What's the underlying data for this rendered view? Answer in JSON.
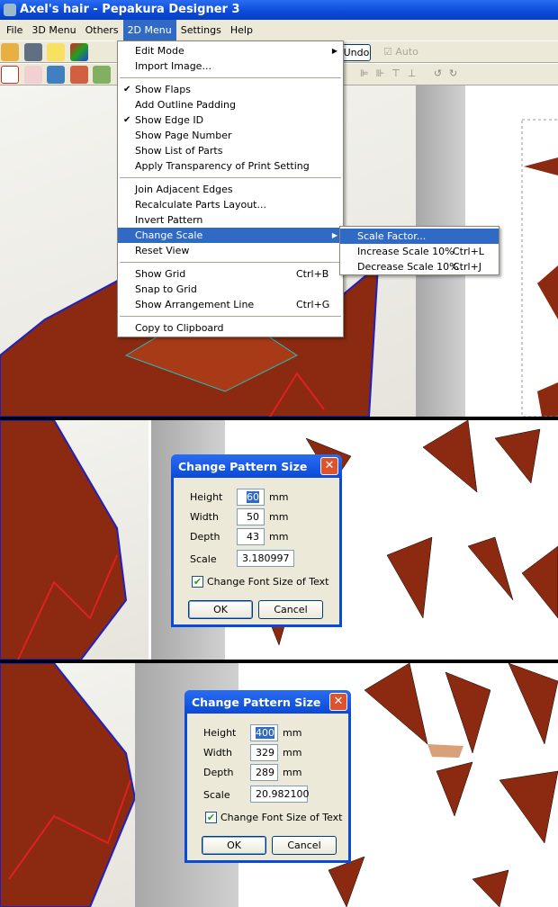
{
  "window": {
    "title": "Axel's hair - Pepakura Designer 3"
  },
  "menubar": [
    "File",
    "3D Menu",
    "Others",
    "2D Menu",
    "Settings",
    "Help"
  ],
  "toolbar": {
    "undo": "Undo",
    "auto": "Auto"
  },
  "menu_2d": {
    "items": [
      {
        "label": "Edit Mode",
        "submenu": true
      },
      {
        "label": "Import Image..."
      },
      {
        "label": "Show Flaps",
        "checked": true
      },
      {
        "label": "Add Outline Padding"
      },
      {
        "label": "Show Edge ID",
        "checked": true
      },
      {
        "label": "Show Page Number"
      },
      {
        "label": "Show List of Parts"
      },
      {
        "label": "Apply Transparency of Print Setting"
      },
      {
        "label": "Join Adjacent Edges"
      },
      {
        "label": "Recalculate Parts Layout..."
      },
      {
        "label": "Invert Pattern"
      },
      {
        "label": "Change Scale",
        "submenu": true,
        "highlighted": true
      },
      {
        "label": "Reset View"
      },
      {
        "label": "Show Grid",
        "shortcut": "Ctrl+B"
      },
      {
        "label": "Snap to Grid"
      },
      {
        "label": "Show Arrangement Line",
        "shortcut": "Ctrl+G"
      },
      {
        "label": "Copy to Clipboard"
      }
    ]
  },
  "submenu_scale": [
    {
      "label": "Scale Factor...",
      "highlighted": true
    },
    {
      "label": "Increase Scale 10%",
      "shortcut": "Ctrl+L"
    },
    {
      "label": "Decrease Scale 10%",
      "shortcut": "Ctrl+J"
    }
  ],
  "dialogs": [
    {
      "title": "Change Pattern Size",
      "height_label": "Height",
      "height": "60",
      "width_label": "Width",
      "width": "50",
      "depth_label": "Depth",
      "depth": "43",
      "unit": "mm",
      "scale_label": "Scale",
      "scale": "3.180997",
      "checkbox": "Change Font Size of Text",
      "checked": true,
      "ok": "OK",
      "cancel": "Cancel",
      "close": "✕"
    },
    {
      "title": "Change Pattern Size",
      "height_label": "Height",
      "height": "400",
      "width_label": "Width",
      "width": "329",
      "depth_label": "Depth",
      "depth": "289",
      "unit": "mm",
      "scale_label": "Scale",
      "scale": "20.982100",
      "checkbox": "Change Font Size of Text",
      "checked": true,
      "ok": "OK",
      "cancel": "Cancel",
      "close": "✕"
    }
  ],
  "colors": {
    "titlebar": "#0a4ad8",
    "highlight": "#316ac5",
    "hair": "#8b2a10",
    "chrome": "#ece9d8"
  }
}
